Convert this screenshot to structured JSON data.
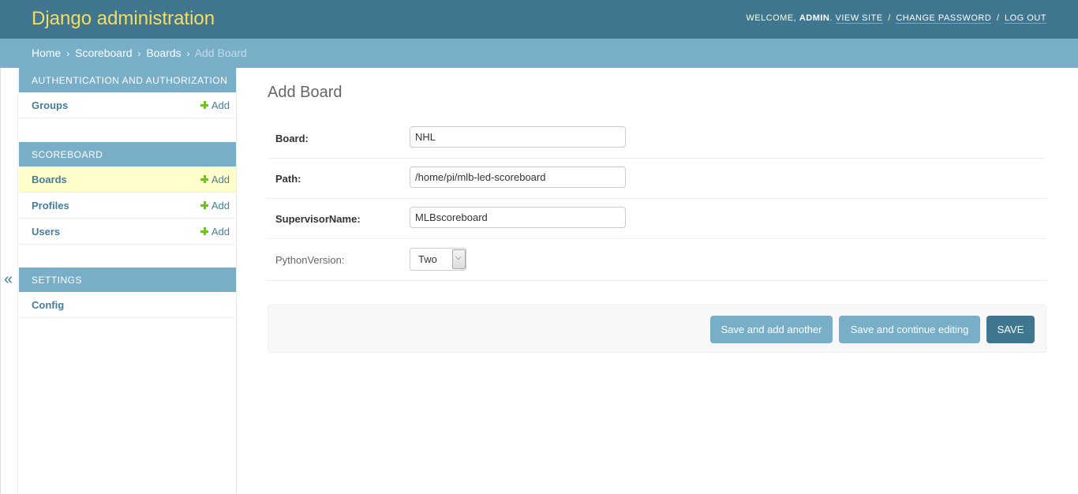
{
  "header": {
    "branding": "Django administration",
    "welcome": "Welcome,",
    "username": "admin",
    "view_site": "View site",
    "change_password": "Change password",
    "log_out": "Log out",
    "separator": "/"
  },
  "breadcrumbs": {
    "home": "Home",
    "app": "Scoreboard",
    "model": "Boards",
    "current": "Add Board",
    "arrow": "›"
  },
  "sidebar": {
    "toggle": "«",
    "add_label": "Add",
    "modules": [
      {
        "caption": "Authentication and Authorization",
        "models": [
          {
            "name": "Groups"
          }
        ]
      },
      {
        "caption": "Scoreboard",
        "models": [
          {
            "name": "Boards"
          },
          {
            "name": "Profiles"
          },
          {
            "name": "Users"
          }
        ]
      },
      {
        "caption": "Settings",
        "models": [
          {
            "name": "Config"
          }
        ]
      }
    ]
  },
  "content": {
    "title": "Add Board",
    "fields": {
      "board": {
        "label": "Board:",
        "value": "NHL"
      },
      "path": {
        "label": "Path:",
        "value": "/home/pi/mlb-led-scoreboard"
      },
      "supervisor": {
        "label": "SupervisorName:",
        "value": "MLBscoreboard"
      },
      "python_version": {
        "label": "PythonVersion:",
        "value": "Two"
      }
    },
    "buttons": {
      "save_add_another": "Save and add another",
      "save_continue": "Save and continue editing",
      "save": "Save"
    }
  },
  "colors": {
    "header_bg": "#417690",
    "breadcrumb_bg": "#79aec8",
    "branding": "#f5dd5d",
    "link": "#447e9b",
    "add_plus": "#70bf2b",
    "selected_row": "#ffffcc"
  }
}
